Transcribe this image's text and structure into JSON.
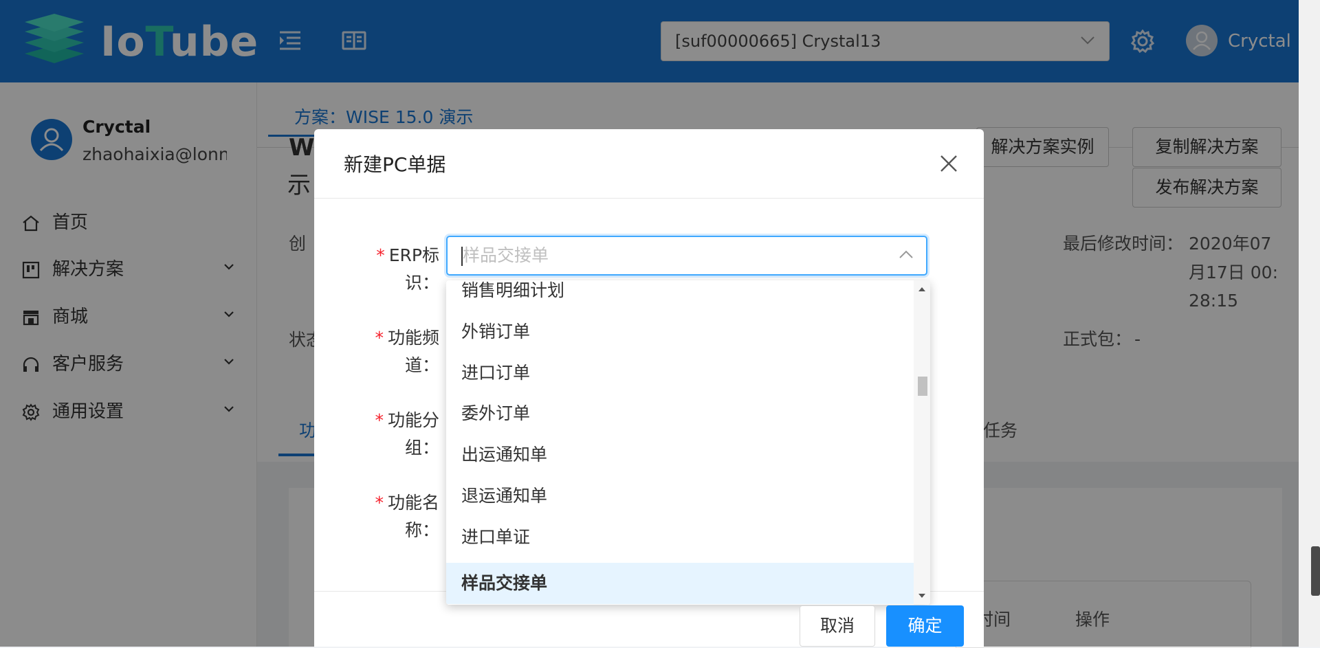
{
  "app": {
    "logo_text_prefix": "Io",
    "logo_text_t": "T",
    "logo_text_suffix": "ube",
    "brand_color": "#1976d2",
    "accent_color": "#2ec6b0"
  },
  "header": {
    "menu_toggle_icon": "outdent-icon",
    "docs_icon": "book-icon",
    "project_select_value": "[suf00000665] Crystal13",
    "settings_icon": "gear-icon",
    "user_name": "Cryctal"
  },
  "sidebar": {
    "user_name": "Cryctal",
    "user_email": "zhaohaixia@lonnt",
    "items": [
      {
        "label": "首页",
        "icon": "home-icon",
        "has_children": false
      },
      {
        "label": "解决方案",
        "icon": "solution-icon",
        "has_children": true
      },
      {
        "label": "商城",
        "icon": "shop-icon",
        "has_children": true
      },
      {
        "label": "客户服务",
        "icon": "headset-icon",
        "has_children": true
      },
      {
        "label": "通用设置",
        "icon": "gear-icon",
        "has_children": true
      }
    ]
  },
  "main": {
    "tab_scheme": "方案：WISE 15.0 演示",
    "title_fragment_1": "W",
    "title_fragment_2": "示",
    "label_created_fragment": "创",
    "label_status_fragment": "状态",
    "button_partial": "解决方案实例",
    "button_copy": "复制解决方案",
    "button_publish": "发布解决方案",
    "last_modified_label": "最后修改时间：",
    "last_modified_value_line1": "2020年07",
    "last_modified_value_line2": "月17日 00:",
    "last_modified_value_line3": "28:15",
    "formal_package_label": "正式包：",
    "formal_package_value": "-",
    "tab_function_fragment": "功",
    "tab_task_fragment": "任务",
    "table_col_time_fragment": "时间",
    "table_col_action": "操作"
  },
  "modal": {
    "title": "新建PC单据",
    "close_icon": "close-icon",
    "fields": {
      "erp_label": "ERP标识：",
      "erp_placeholder": "样品交接单",
      "channel_label": "功能频道：",
      "group_label": "功能分组：",
      "name_label": "功能名称："
    },
    "dropdown_options": [
      {
        "label": "销售明细计划",
        "selected": false
      },
      {
        "label": "外销订单",
        "selected": false
      },
      {
        "label": "进口订单",
        "selected": false
      },
      {
        "label": "委外订单",
        "selected": false
      },
      {
        "label": "出运通知单",
        "selected": false
      },
      {
        "label": "退运通知单",
        "selected": false
      },
      {
        "label": "进口单证",
        "selected": false
      },
      {
        "label": "样品交接单",
        "selected": true
      }
    ],
    "cancel_label": "取消",
    "ok_label": "确定",
    "primary_color": "#1890ff",
    "required_color": "#f5222d"
  }
}
